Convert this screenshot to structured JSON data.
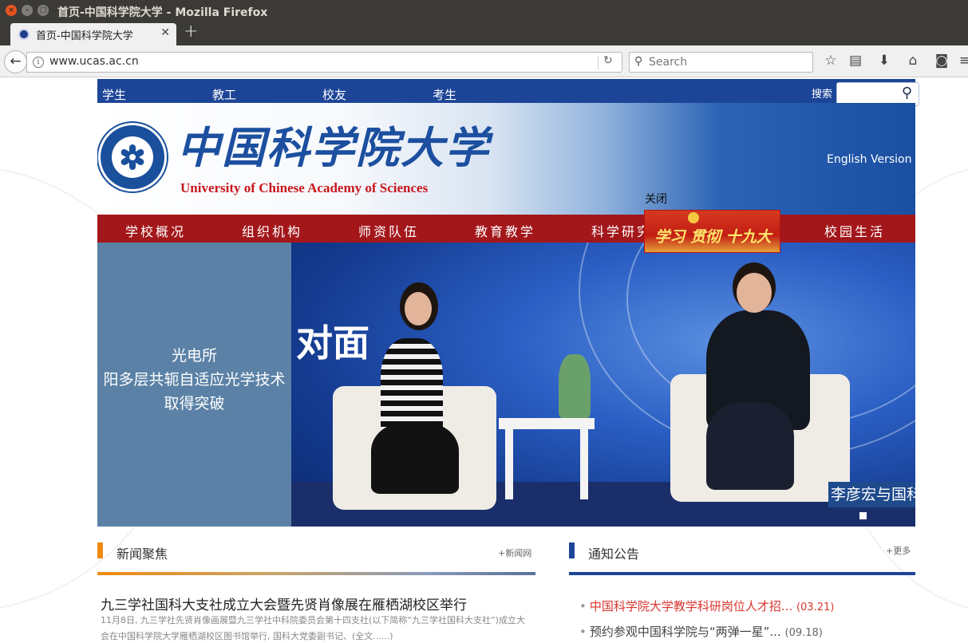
{
  "window": {
    "title": "首页-中国科学院大学 - Mozilla Firefox"
  },
  "browser": {
    "tab_title": "首页-中国科学院大学",
    "url": "www.ucas.ac.cn",
    "search_placeholder": "Search"
  },
  "site": {
    "top_links": [
      "学生",
      "教工",
      "校友",
      "考生"
    ],
    "search_label": "搜索",
    "logo_cn": "中国科学院大学",
    "logo_en": "University of  Chinese Academy of Sciences",
    "english_version": "English Version",
    "main_nav": [
      "学校概况",
      "组织机构",
      "师资队伍",
      "教育教学",
      "科学研究",
      "校园生活"
    ],
    "hero": {
      "side_text": [
        "光电所",
        "阳多层共轭自适应光学技术",
        "取得突破"
      ],
      "stage_text": "对面",
      "caption": "李彦宏与国科"
    },
    "popup": {
      "close_label": "关闭",
      "ad_text": "学习 贯彻 十九大"
    },
    "news": {
      "title": "新闻聚焦",
      "more": "+新闻网",
      "headline": "九三学社国科大支社成立大会暨先贤肖像展在雁栖湖校区举行",
      "summary": "11月8日, 九三学社先贤肖像画展暨九三学社中科院委员会第十四支社(以下简称“九三学社国科大支社”)成立大会在中国科学院大学雁栖湖校区图书馆举行, 国科大党委副书记、(全文......)"
    },
    "notices": {
      "title": "通知公告",
      "more": "+更多",
      "items": [
        {
          "text": "中国科学院大学教学科研岗位人才招...",
          "date": "(03.21)",
          "color": "#d9362f"
        },
        {
          "text": "预约参观中国科学院与“两弹一星”...",
          "date": "(09.18)",
          "color": "#444444"
        }
      ]
    }
  },
  "colors": {
    "topbar_blue": "#1d4597",
    "nav_red": "#a3171b",
    "news_accent": "#f08a12",
    "notice_accent": "#1d4597"
  }
}
